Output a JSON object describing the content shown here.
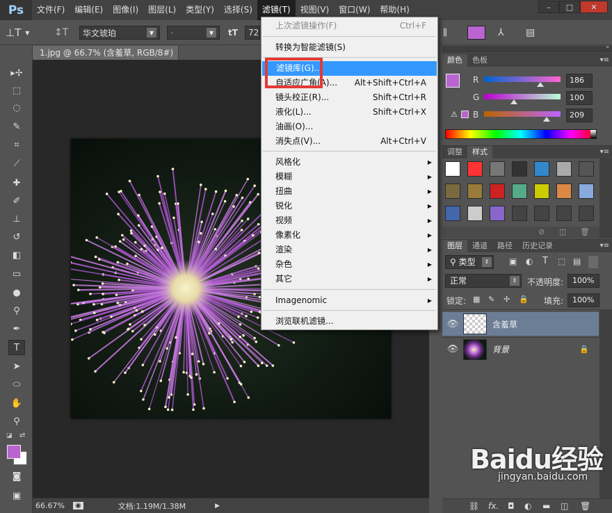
{
  "app_logo": "Ps",
  "menubar": {
    "items": [
      "文件(F)",
      "编辑(E)",
      "图像(I)",
      "图层(L)",
      "类型(Y)",
      "选择(S)",
      "滤镜(T)",
      "视图(V)",
      "窗口(W)",
      "帮助(H)"
    ],
    "active": "滤镜(T)"
  },
  "window_controls": {
    "minimize": "–",
    "restore": "□",
    "close": "✕"
  },
  "options_bar": {
    "font_family": "华文琥珀",
    "font_style": "-",
    "font_size_icon": "tT",
    "font_size": "72",
    "color": "#ba64d1"
  },
  "document": {
    "tab_title": "1.jpg @ 66.7% (含羞草, RGB/8#) *",
    "tab_close": "×"
  },
  "statusbar": {
    "zoom": "66.67%",
    "doc_info": "文档:1.19M/1.38M"
  },
  "filter_menu": {
    "items": [
      {
        "label": "上次滤镜操作(F)",
        "shortcut": "Ctrl+F",
        "disabled": true
      },
      {
        "label": "转换为智能滤镜(S)",
        "shortcut": ""
      },
      {
        "label": "滤镜库(G)...",
        "shortcut": "",
        "highlighted": true
      },
      {
        "label": "自适应广角(A)...",
        "shortcut": "Alt+Shift+Ctrl+A"
      },
      {
        "label": "镜头校正(R)...",
        "shortcut": "Shift+Ctrl+R"
      },
      {
        "label": "液化(L)...",
        "shortcut": "Shift+Ctrl+X"
      },
      {
        "label": "油画(O)...",
        "shortcut": ""
      },
      {
        "label": "消失点(V)...",
        "shortcut": "Alt+Ctrl+V"
      },
      {
        "label": "风格化",
        "submenu": true
      },
      {
        "label": "模糊",
        "submenu": true
      },
      {
        "label": "扭曲",
        "submenu": true
      },
      {
        "label": "锐化",
        "submenu": true
      },
      {
        "label": "视频",
        "submenu": true
      },
      {
        "label": "像素化",
        "submenu": true
      },
      {
        "label": "渲染",
        "submenu": true
      },
      {
        "label": "杂色",
        "submenu": true
      },
      {
        "label": "其它",
        "submenu": true
      },
      {
        "label": "Imagenomic",
        "submenu": true
      },
      {
        "label": "浏览联机滤镜..."
      }
    ]
  },
  "color_panel": {
    "tabs": [
      "颜色",
      "色板"
    ],
    "active_tab": "颜色",
    "channels": [
      {
        "label": "R",
        "value": "186"
      },
      {
        "label": "G",
        "value": "100"
      },
      {
        "label": "B",
        "value": "209"
      }
    ],
    "fg_color": "#ba64d1"
  },
  "styles_panel": {
    "tabs": [
      "调整",
      "样式"
    ],
    "active_tab": "样式"
  },
  "layers_panel": {
    "tabs": [
      "图层",
      "通道",
      "路径",
      "历史记录"
    ],
    "active_tab": "图层",
    "filter_kind": "类型",
    "blend_mode": "正常",
    "opacity_label": "不透明度:",
    "opacity_value": "100%",
    "lock_label": "锁定:",
    "fill_label": "填充:",
    "fill_value": "100%",
    "layers": [
      {
        "name": "含羞草",
        "selected": true,
        "locked": false
      },
      {
        "name": "背景",
        "selected": false,
        "locked": true
      }
    ]
  },
  "watermark": {
    "brand": "Baidu经验",
    "url": "jingyan.baidu.com"
  }
}
